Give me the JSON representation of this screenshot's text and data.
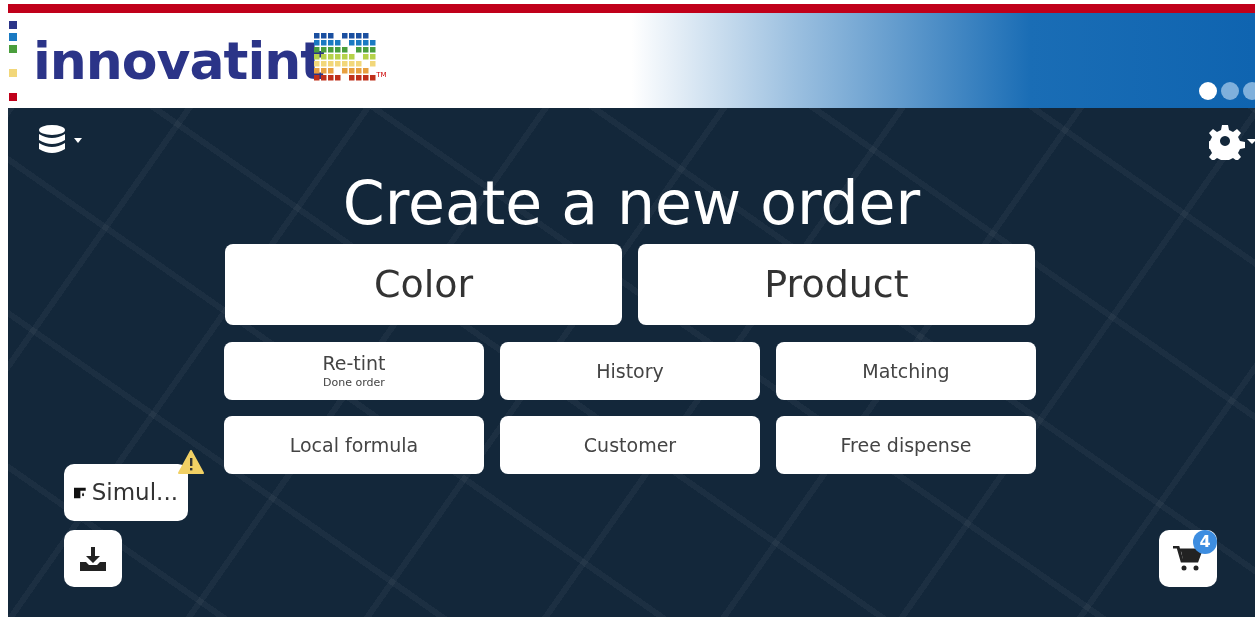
{
  "header": {
    "logo_text": "innovatint",
    "trademark": "TM",
    "slides": [
      {
        "selected": true
      },
      {
        "selected": false
      },
      {
        "selected": false
      }
    ]
  },
  "title": "Create a new order",
  "main_buttons": [
    {
      "label": "Color"
    },
    {
      "label": "Product"
    }
  ],
  "buttons": [
    {
      "label": "Re-tint",
      "sublabel": "Done order"
    },
    {
      "label": "History"
    },
    {
      "label": "Matching"
    },
    {
      "label": "Local formula"
    },
    {
      "label": "Customer"
    },
    {
      "label": "Free dispense"
    }
  ],
  "machine": {
    "label": "Simul...",
    "warning": true
  },
  "cart": {
    "count": "4"
  }
}
